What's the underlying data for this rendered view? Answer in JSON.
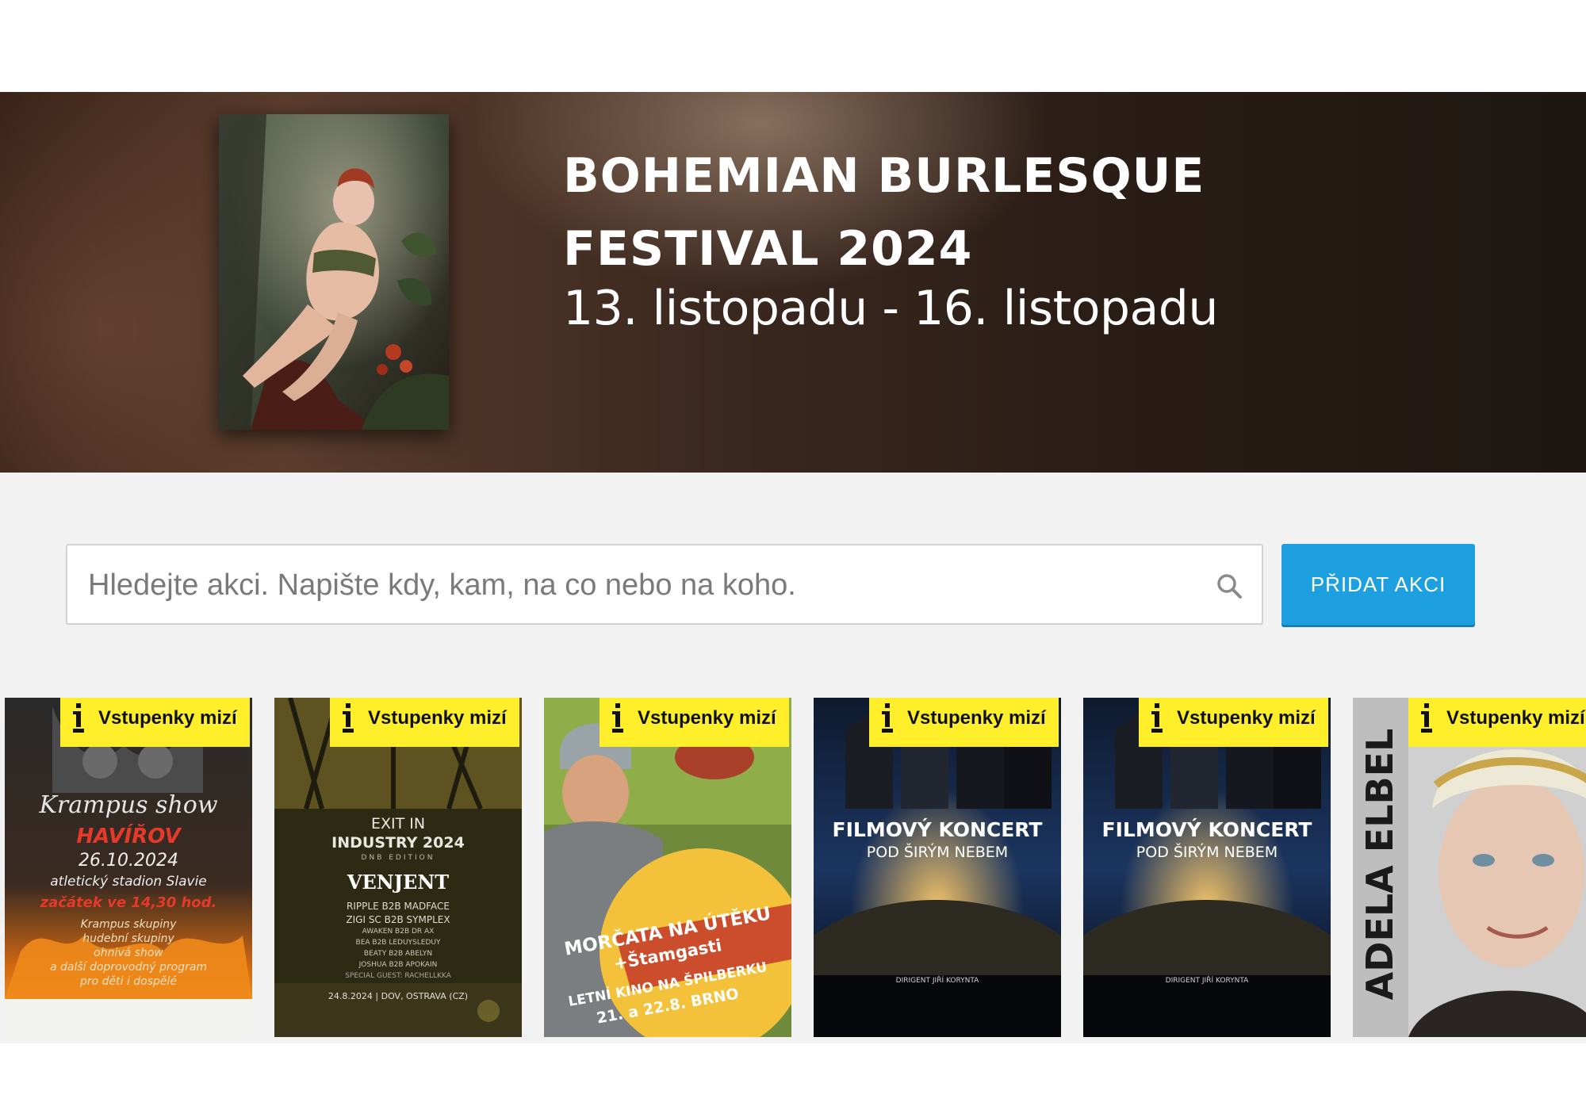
{
  "hero": {
    "title": "BOHEMIAN BURLESQUE FESTIVAL 2024",
    "dates": "13. listopadu - 16. listopadu"
  },
  "search": {
    "placeholder": "Hledejte akci. Napište kdy, kam, na co nebo na koho.",
    "icon": "search-icon"
  },
  "add_event": {
    "label": "PŘIDAT AKCI",
    "color": "#1ea0e0"
  },
  "badge_color": "#ffef2a",
  "cards": [
    {
      "badge": "Vstupenky mizí",
      "poster_lines": [
        "Krampus show",
        "HAVÍŘOV",
        "26.10.2024",
        "atletický stadion Slavie",
        "začátek ve 14,30 hod.",
        "Krampus skupiny",
        "hudební skupiny",
        "ohnivá show",
        "a další doprovodný program",
        "pro děti i dospělé"
      ]
    },
    {
      "badge": "Vstupenky mizí",
      "poster_lines": [
        "EXIT IN",
        "INDUSTRY 2024",
        "DNB EDITION",
        "VENJENT",
        "RIPPLE B2B MADFACE",
        "ZIGI SC B2B SYMPLEX",
        "AWAKEN B2B DR AX",
        "BEA B2B LEDUYSLEDUY",
        "BEATY B2B ABELYN",
        "JOSHUA B2B APOKAIN",
        "SPECIAL GUEST: RACHELLKKA",
        "24.8.2024 | DOV, OSTRAVA (CZ)"
      ]
    },
    {
      "badge": "Vstupenky mizí",
      "poster_lines": [
        "MORČATA NA ÚTĚKU",
        "+Štamgasti",
        "LETNÍ KINO NA ŠPILBERKU",
        "21. a 22.8. BRNO"
      ]
    },
    {
      "badge": "Vstupenky mizí",
      "poster_lines": [
        "FILMOVÝ KONCERT",
        "POD ŠIRÝM NEBEM",
        "DIRIGENT JIŘÍ KORYNTA"
      ]
    },
    {
      "badge": "Vstupenky mizí",
      "poster_lines": [
        "FILMOVÝ KONCERT",
        "POD ŠIRÝM NEBEM",
        "DIRIGENT JIŘÍ KORYNTA"
      ]
    },
    {
      "badge": "Vstupenky mizí",
      "poster_lines": [
        "ADELA ELBEL"
      ]
    }
  ]
}
